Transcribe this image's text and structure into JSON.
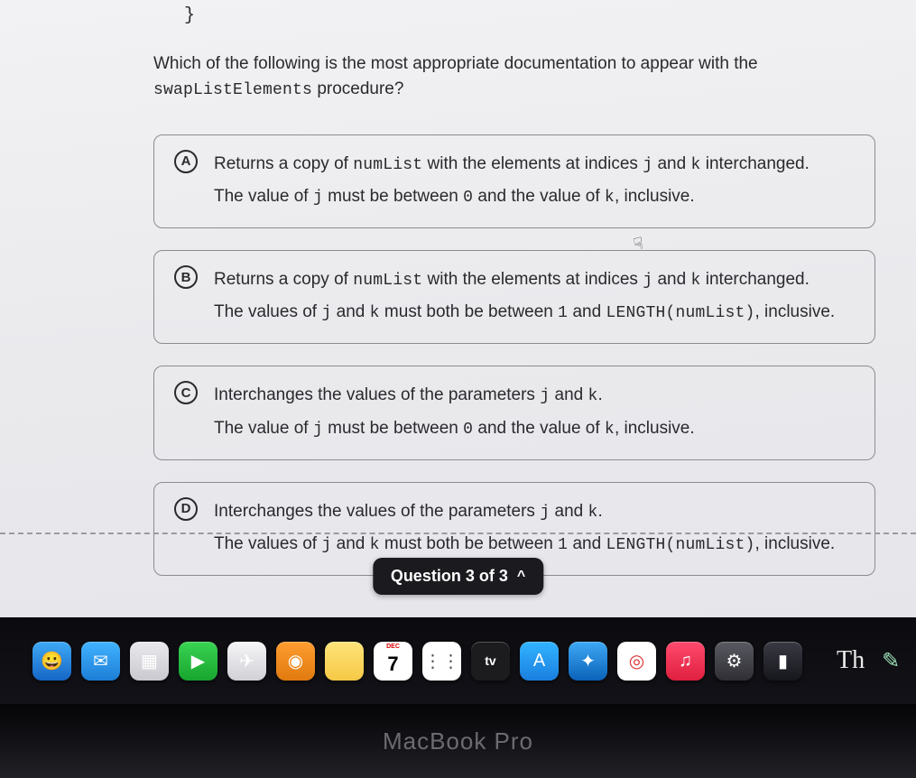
{
  "code_fragment": "}",
  "question_pre": "Which of the following is the most appropriate documentation to appear with the ",
  "question_code": "swapListElements",
  "question_post": " procedure?",
  "options": [
    {
      "letter": "A",
      "segments": [
        {
          "t": "Returns a copy of "
        },
        {
          "t": "numList",
          "code": true
        },
        {
          "t": " with the elements at indices "
        },
        {
          "t": "j",
          "code": true
        },
        {
          "t": " and "
        },
        {
          "t": "k",
          "code": true
        },
        {
          "t": " interchanged."
        },
        {
          "br": true
        },
        {
          "t": "The value of "
        },
        {
          "t": "j",
          "code": true
        },
        {
          "t": " must be between "
        },
        {
          "t": "0",
          "code": true
        },
        {
          "t": " and the value of "
        },
        {
          "t": "k",
          "code": true
        },
        {
          "t": ", inclusive."
        }
      ]
    },
    {
      "letter": "B",
      "segments": [
        {
          "t": "Returns a copy of "
        },
        {
          "t": "numList",
          "code": true
        },
        {
          "t": " with the elements at indices "
        },
        {
          "t": "j",
          "code": true
        },
        {
          "t": " and "
        },
        {
          "t": "k",
          "code": true
        },
        {
          "t": " interchanged."
        },
        {
          "br": true
        },
        {
          "t": "The values of "
        },
        {
          "t": "j",
          "code": true
        },
        {
          "t": " and "
        },
        {
          "t": "k",
          "code": true
        },
        {
          "t": " must both be between "
        },
        {
          "t": "1",
          "code": true
        },
        {
          "t": " and "
        },
        {
          "t": "LENGTH(numList)",
          "code": true
        },
        {
          "t": ", inclusive."
        }
      ]
    },
    {
      "letter": "C",
      "segments": [
        {
          "t": "Interchanges the values of the parameters "
        },
        {
          "t": "j",
          "code": true
        },
        {
          "t": " and "
        },
        {
          "t": "k",
          "code": true
        },
        {
          "t": "."
        },
        {
          "br": true
        },
        {
          "t": "The value of "
        },
        {
          "t": "j",
          "code": true
        },
        {
          "t": " must be between "
        },
        {
          "t": "0",
          "code": true
        },
        {
          "t": " and the value of "
        },
        {
          "t": "k",
          "code": true
        },
        {
          "t": ", inclusive."
        }
      ]
    },
    {
      "letter": "D",
      "segments": [
        {
          "t": "Interchanges the values of the parameters "
        },
        {
          "t": "j",
          "code": true
        },
        {
          "t": " and "
        },
        {
          "t": "k",
          "code": true
        },
        {
          "t": "."
        },
        {
          "br": true
        },
        {
          "t": "The values of "
        },
        {
          "t": "j",
          "code": true
        },
        {
          "t": " and "
        },
        {
          "t": "k",
          "code": true
        },
        {
          "t": " must both be between "
        },
        {
          "t": "1",
          "code": true
        },
        {
          "t": " and "
        },
        {
          "t": "LENGTH(numList)",
          "code": true
        },
        {
          "t": ", inclusive."
        }
      ]
    }
  ],
  "pager": {
    "label": "Question 3 of 3",
    "chevron": "^"
  },
  "dock": [
    {
      "name": "finder-icon",
      "bg": "linear-gradient(#3ea9f5,#1666c6)",
      "glyph": "😀"
    },
    {
      "name": "mail-icon",
      "bg": "linear-gradient(#42b3ff,#1c7ed6)",
      "glyph": "✉"
    },
    {
      "name": "launchpad-icon",
      "bg": "linear-gradient(#e9e9ed,#c9c9cf)",
      "glyph": "▦"
    },
    {
      "name": "facetime-icon",
      "bg": "linear-gradient(#39d353,#18a52e)",
      "glyph": "▶"
    },
    {
      "name": "maps-icon",
      "bg": "linear-gradient(#f6f6f8,#d0d0d6)",
      "glyph": "✈"
    },
    {
      "name": "photos-icon",
      "bg": "linear-gradient(#ff9d2f,#e07a10)",
      "glyph": "◉"
    },
    {
      "name": "notes-icon",
      "bg": "linear-gradient(#ffe47a,#f6c945)",
      "glyph": ""
    },
    {
      "name": "calendar-icon",
      "bg": "#fff",
      "glyph": "7",
      "text_color": "#000",
      "badge": "DEC"
    },
    {
      "name": "reminders-icon",
      "bg": "#fff",
      "glyph": "⋮⋮",
      "text_color": "#555"
    },
    {
      "name": "appletv-icon",
      "bg": "#1c1c1e",
      "glyph": "tv",
      "small": true
    },
    {
      "name": "appstore-icon",
      "bg": "linear-gradient(#32b4ff,#1a7fe0)",
      "glyph": "A"
    },
    {
      "name": "safari-icon",
      "bg": "linear-gradient(#3ea9f5,#0b62b8)",
      "glyph": "✦"
    },
    {
      "name": "chrome-icon",
      "bg": "#fff",
      "glyph": "◎",
      "text_color": "#d33"
    },
    {
      "name": "music-icon",
      "bg": "linear-gradient(#ff4b6e,#e0203f)",
      "glyph": "♫"
    },
    {
      "name": "settings-icon",
      "bg": "linear-gradient(#5a5a62,#2e2e34)",
      "glyph": "⚙"
    },
    {
      "name": "iphone-mirror-icon",
      "bg": "linear-gradient(#3a3a44,#16161c)",
      "glyph": "▮"
    }
  ],
  "dock_right": {
    "text": "Th",
    "pen_glyph": "✎"
  },
  "bezel": "MacBook Pro"
}
